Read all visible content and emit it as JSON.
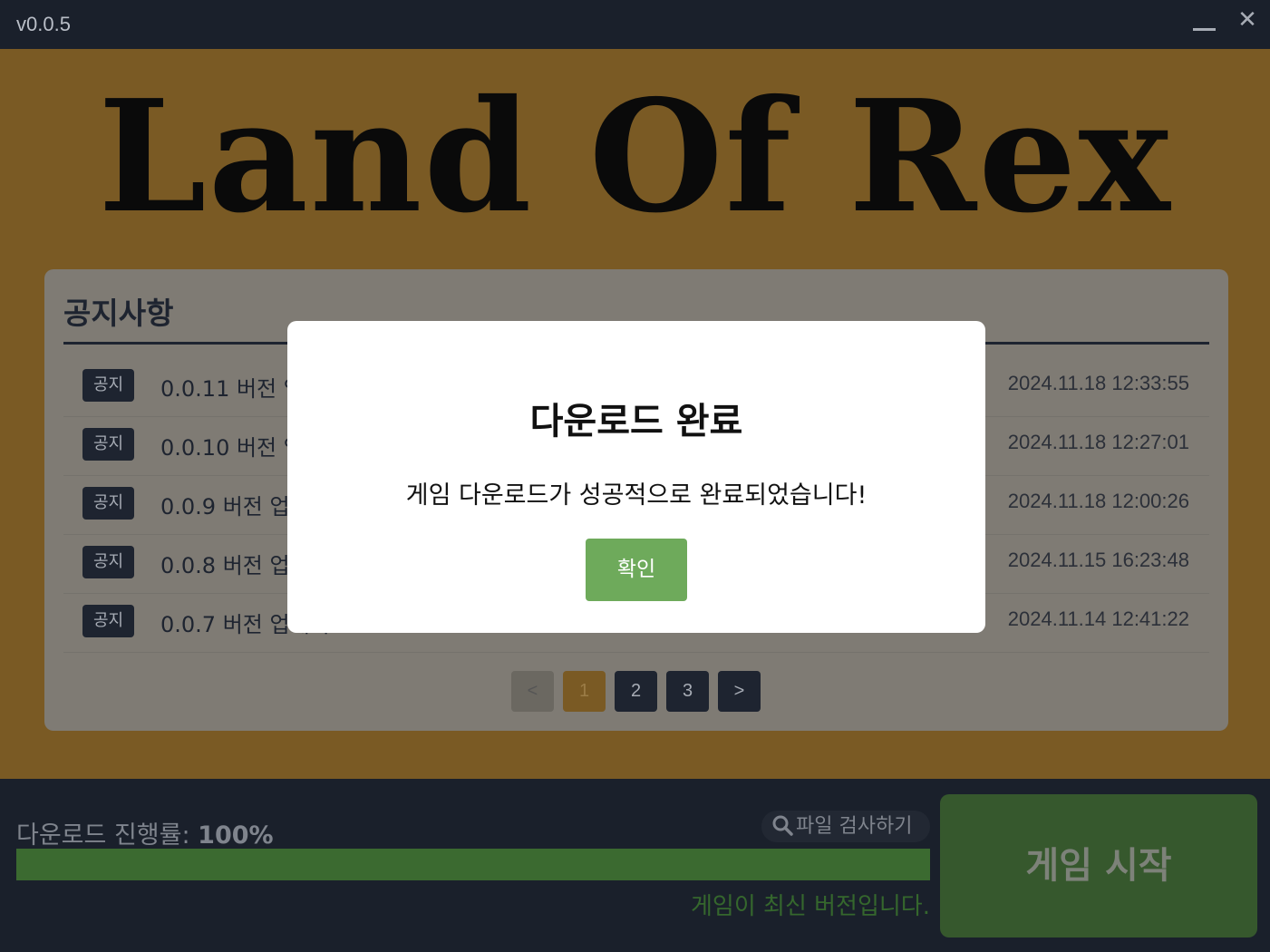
{
  "titlebar": {
    "version": "v0.0.5",
    "minimize_icon": "minimize-icon",
    "close_icon": "close-icon",
    "close_glyph": "✕"
  },
  "hero": {
    "logo_text": "Land Of Rex"
  },
  "notices": {
    "title": "공지사항",
    "items": [
      {
        "badge": "공지",
        "title": "0.0.11 버전 업",
        "date": "2024.11.18 12:33:55"
      },
      {
        "badge": "공지",
        "title": "0.0.10 버전 업",
        "date": "2024.11.18 12:27:01"
      },
      {
        "badge": "공지",
        "title": "0.0.9 버전 업데",
        "date": "2024.11.18 12:00:26"
      },
      {
        "badge": "공지",
        "title": "0.0.8 버전 업데",
        "date": "2024.11.15 16:23:48"
      },
      {
        "badge": "공지",
        "title": "0.0.7 버전 업데이",
        "date": "2024.11.14 12:41:22"
      }
    ],
    "pagination": {
      "prev": "<",
      "pages": [
        "1",
        "2",
        "3"
      ],
      "current": "1",
      "next": ">"
    }
  },
  "modal": {
    "title": "다운로드 완료",
    "message": "게임 다운로드가 성공적으로 완료되었습니다!",
    "ok_label": "확인"
  },
  "download": {
    "label": "다운로드 진행률: ",
    "percent_text": "100%",
    "progress": 1.0,
    "check_files_label": "파일 검사하기",
    "check_files_icon": "search-icon",
    "status": "게임이 최신 버전입니다.",
    "start_label": "게임 시작"
  },
  "colors": {
    "hero_bg": "#7a5a24",
    "panel_bg": "#1a202b",
    "progress_fill": "#3b6a30",
    "start_button": "#36582d",
    "ok_button": "#6eaa5b",
    "active_page": "#7a5a24"
  }
}
